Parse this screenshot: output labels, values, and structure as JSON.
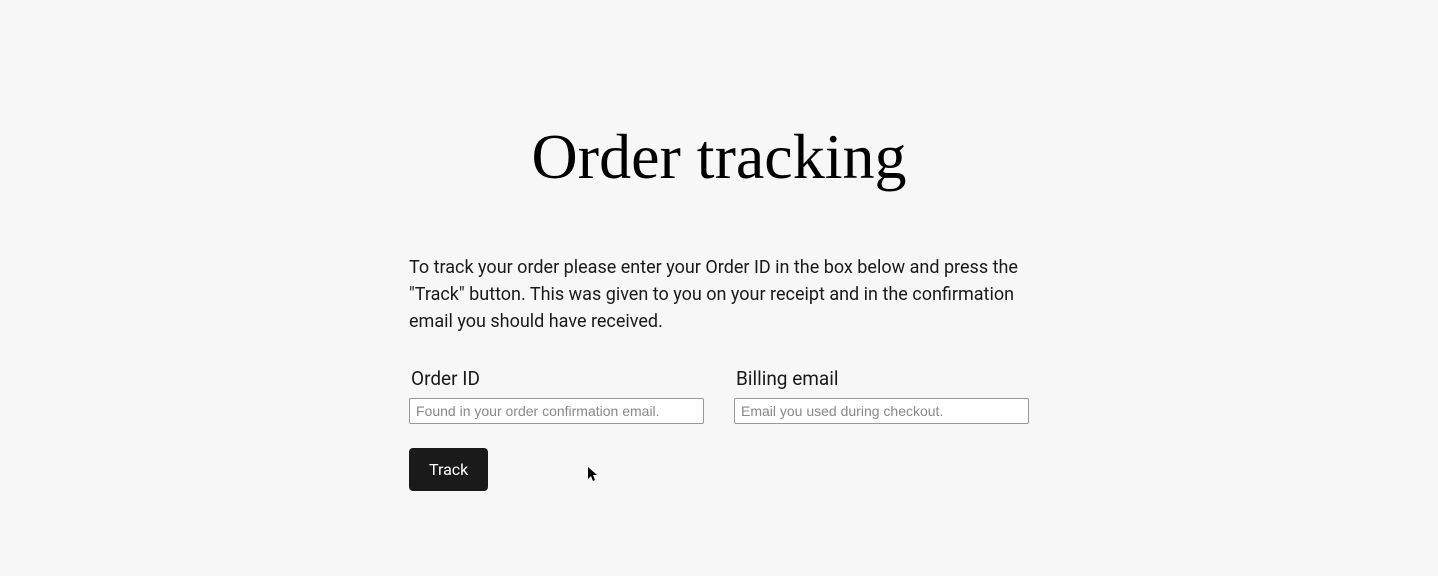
{
  "header": {
    "title": "Order tracking"
  },
  "main": {
    "description": "To track your order please enter your Order ID in the box below and press the \"Track\" button. This was given to you on your receipt and in the confirmation email you should have received.",
    "form": {
      "order_id": {
        "label": "Order ID",
        "placeholder": "Found in your order confirmation email.",
        "value": ""
      },
      "billing_email": {
        "label": "Billing email",
        "placeholder": "Email you used during checkout.",
        "value": ""
      },
      "submit_label": "Track"
    }
  }
}
